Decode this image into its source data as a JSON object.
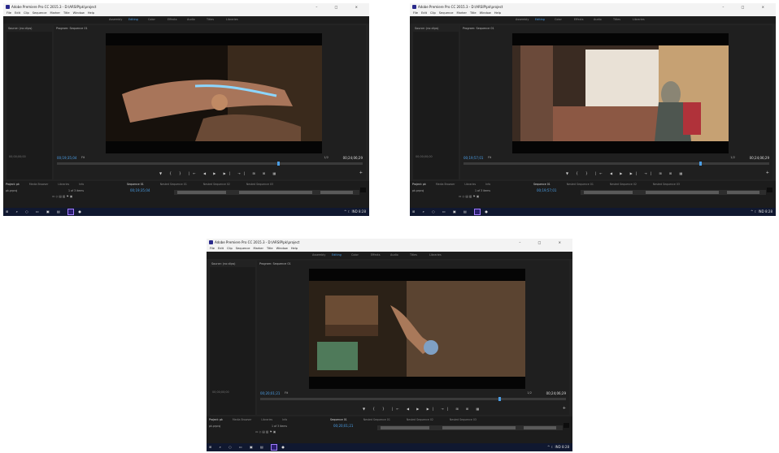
{
  "app": {
    "title": "Adobe Premiere Pro CC 2015.3 - D:\\ARSIP\\pk\\project",
    "menu": [
      "File",
      "Edit",
      "Clip",
      "Sequence",
      "Marker",
      "Title",
      "Window",
      "Help"
    ],
    "workspaces": [
      "Assembly",
      "Editing",
      "Color",
      "Effects",
      "Audio",
      "Titles",
      "Libraries"
    ],
    "active_workspace": "Editing",
    "window_controls": "– □ ×"
  },
  "panels": {
    "source_tab": "Source: (no clips)",
    "program_tab": "Program: Sequence 01",
    "left_timecode": "00;00;00;00",
    "fit": "Fit",
    "zoom": "1/2",
    "duration": "00;24;06;29",
    "transport": "▼ { } |← ◀ ▶ ▶| →| ⊞ ⊞ ▦",
    "project_tabs": [
      "Project: pk",
      "Media Browser",
      "Libraries",
      "Info"
    ],
    "project_name": "pk.prproj",
    "items_count": "1 of 3 items",
    "sequence_tabs": [
      "Sequence 01",
      "Nested Sequence 01",
      "Nested Sequence 02",
      "Nested Sequence 03"
    ]
  },
  "taskbar": {
    "tray": "^ ☾ IND 8:28"
  },
  "screens": [
    {
      "timecode": "00;19;35;04",
      "seq_timecode": "00;19;35;04",
      "scene": "hand-with-iv-tube",
      "playhead": 0.72
    },
    {
      "timecode": "00;19;57;01",
      "seq_timecode": "00;19;57;01",
      "scene": "woman-at-window-desk",
      "playhead": 0.77
    },
    {
      "timecode": "00;20;01;21",
      "seq_timecode": "00;20;01;21",
      "scene": "hand-reaching-wooden-box",
      "playhead": 0.78
    }
  ],
  "colors": {
    "accent": "#4b9ee6",
    "panel_bg": "#232323",
    "titlebar_bg": "#f3f3f3"
  }
}
